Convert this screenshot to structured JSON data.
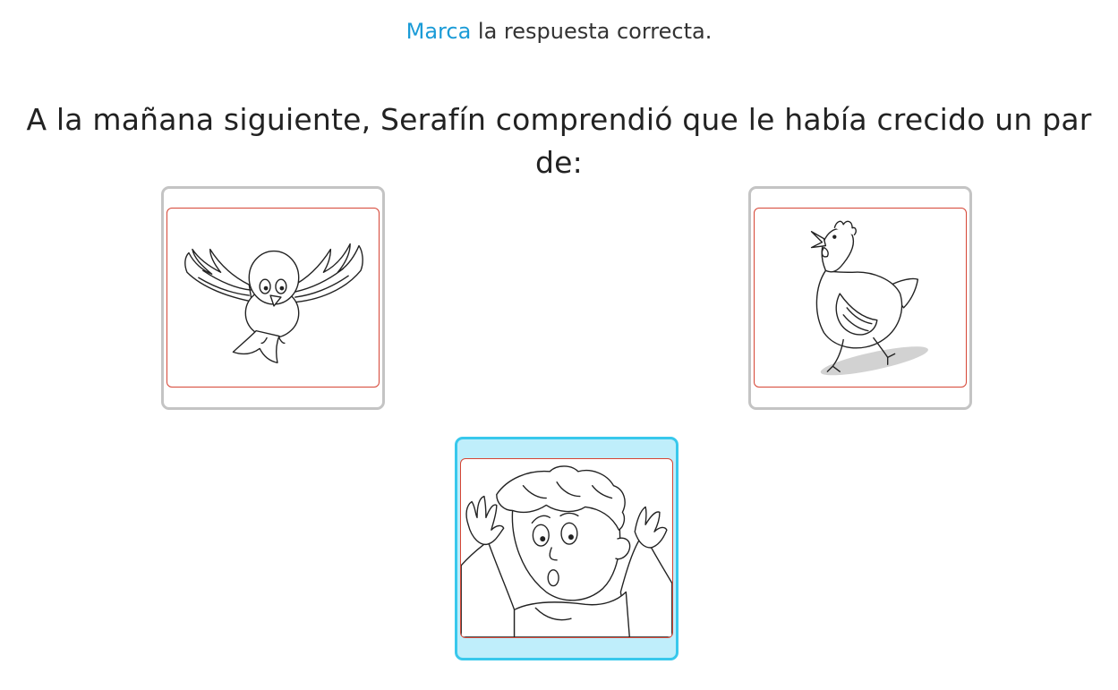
{
  "instruction": {
    "highlight": "Marca",
    "rest": " la respuesta correcta."
  },
  "question": {
    "text": "A la mañana siguiente, Serafín comprendió que le había crecido un par de:"
  },
  "options": [
    {
      "image": "bird-drawing",
      "selected": false
    },
    {
      "image": "hen-drawing",
      "selected": false
    },
    {
      "image": "boy-drawing",
      "selected": true
    }
  ],
  "colors": {
    "accent": "#1a9bd7",
    "card_border": "#c4c4c4",
    "selected_border": "#38c8ec",
    "selected_fill": "#bfeefb",
    "frame_border": "#d64535"
  }
}
